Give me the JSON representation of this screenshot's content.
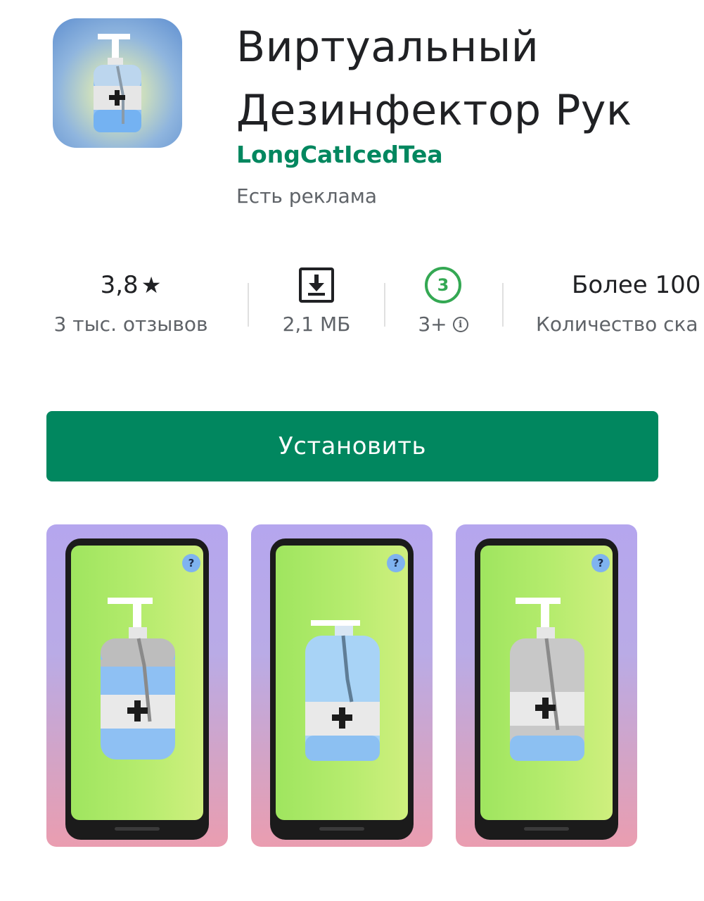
{
  "app": {
    "title_line1": "Виртуальный",
    "title_line2": "Дезинфектор Рук",
    "developer": "LongCatIcedTea",
    "ads_label": "Есть реклама",
    "icon_name": "hand-sanitizer-icon"
  },
  "stats": {
    "rating": {
      "value": "3,8",
      "star": "★",
      "subtitle": "3 тыс. отзывов"
    },
    "size": {
      "icon": "download-icon",
      "subtitle": "2,1 МБ"
    },
    "age": {
      "badge": "3",
      "subtitle": "3+"
    },
    "downloads": {
      "value": "Более 100",
      "subtitle": "Количество ска"
    }
  },
  "install": {
    "label": "Установить"
  },
  "screenshots": [
    {
      "help": "?"
    },
    {
      "help": "?"
    },
    {
      "help": "?"
    }
  ],
  "colors": {
    "accent": "#01875f",
    "rating_badge": "#34a853",
    "text_primary": "#202124",
    "text_secondary": "#5f6368"
  }
}
